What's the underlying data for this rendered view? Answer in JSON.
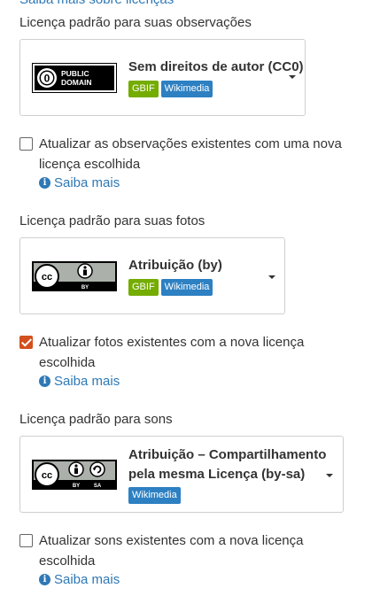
{
  "top_link": "Saiba mais sobre licenças",
  "observations": {
    "label": "Licença padrão para suas observações",
    "license_name": "Sem direitos de autor (CC0)",
    "tags": [
      "GBIF",
      "Wikimedia"
    ],
    "badge": {
      "top": "PUBLIC",
      "bottom": "DOMAIN"
    },
    "update_checkbox_label": "Atualizar as observações existentes com uma nova licença escolhida",
    "update_checked": false,
    "learn_more": "Saiba mais"
  },
  "photos": {
    "label": "Licença padrão para suas fotos",
    "license_name": "Atribuição (by)",
    "tags": [
      "GBIF",
      "Wikimedia"
    ],
    "badge": {
      "caption": "BY"
    },
    "update_checkbox_label": "Atualizar fotos existentes com a nova licença escolhida",
    "update_checked": true,
    "learn_more": "Saiba mais"
  },
  "sounds": {
    "label": "Licença padrão para sons",
    "license_name": "Atribuição – Compartilhamento pela mesma Licença (by-sa)",
    "tags": [
      "Wikimedia"
    ],
    "badge": {
      "caption_by": "BY",
      "caption_sa": "SA"
    },
    "update_checkbox_label": "Atualizar sons existentes com a nova licença escolhida",
    "update_checked": false,
    "learn_more": "Saiba mais"
  },
  "colors": {
    "link": "#2e78b5",
    "gbif_tag": "#74ac00",
    "wikimedia_tag": "#2d80c2",
    "checkbox_checked": "#d2501e"
  },
  "icons": [
    "public-domain-badge",
    "cc-by-badge",
    "cc-by-sa-badge",
    "info-icon",
    "caret-down-icon"
  ]
}
